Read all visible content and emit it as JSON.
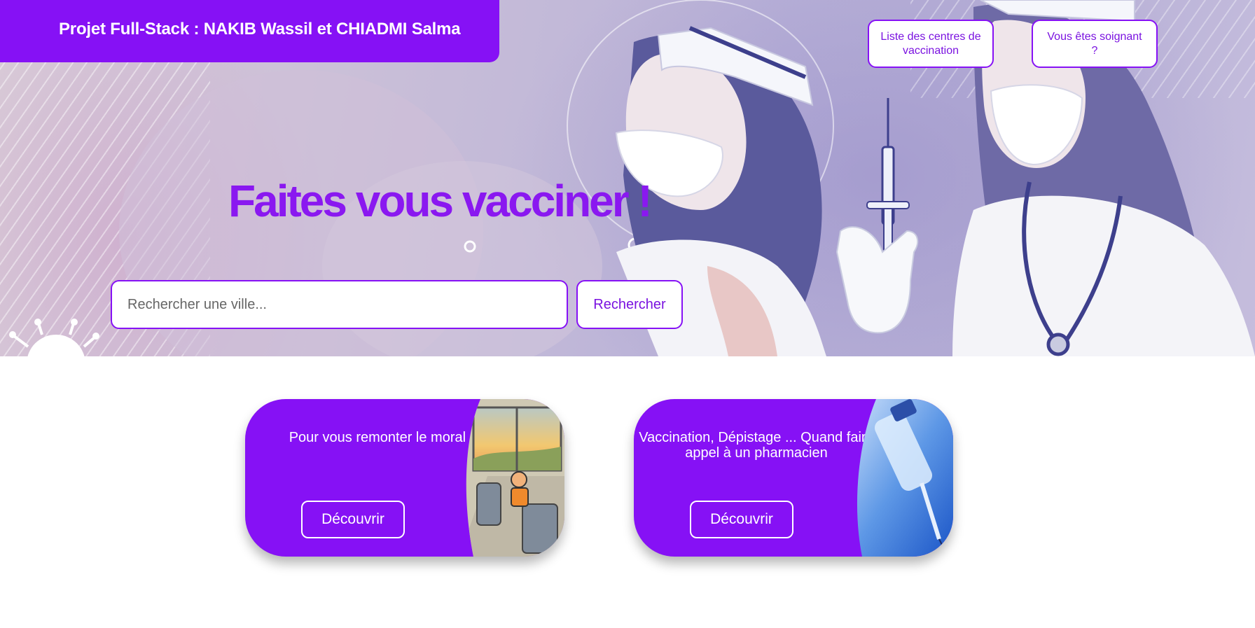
{
  "header": {
    "title": "Projet Full-Stack : NAKIB Wassil et CHIADMI Salma"
  },
  "nav": {
    "centres_label": "Liste des centres de vaccination",
    "soignant_label": "Vous êtes soignant ?"
  },
  "hero": {
    "headline": "Faites vous vacciner !"
  },
  "search": {
    "placeholder": "Rechercher une ville...",
    "button_label": "Rechercher"
  },
  "cards": [
    {
      "text": "Pour vous remonter le moral ...",
      "button_label": "Découvrir",
      "image": "cartoon-bus-illustration"
    },
    {
      "text": "Vaccination, Dépistage ... Quand faire appel à un pharmacien",
      "button_label": "Découvrir",
      "image": "vaccine-vial-syringe-photo"
    }
  ],
  "colors": {
    "brand": "#8611f5",
    "white": "#ffffff"
  }
}
